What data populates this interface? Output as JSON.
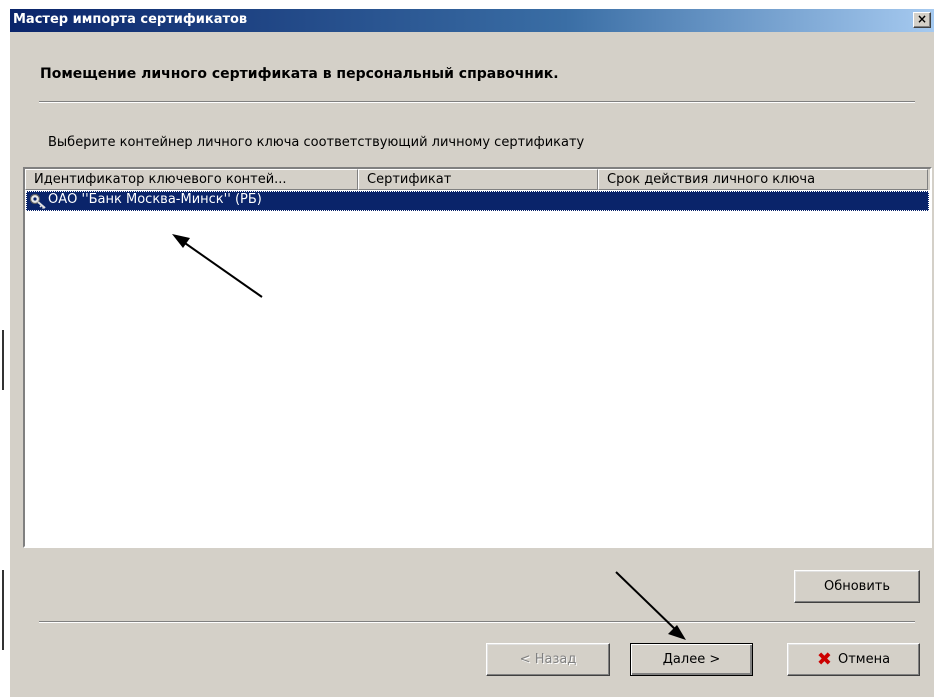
{
  "window": {
    "title": "Мастер импорта сертификатов",
    "close_glyph": "×"
  },
  "heading": "Помещение личного сертификата в персональный справочник.",
  "instruction": "Выберите контейнер личного ключа соответствующий личному сертификату",
  "list": {
    "columns": [
      "Идентификатор ключевого контей...",
      "Сертификат",
      "Срок действия личного ключа"
    ],
    "rows": [
      {
        "icon": "key-icon",
        "name": "ОАО ''Банк Москва-Минск'' (РБ)",
        "certificate": "",
        "expiry": "",
        "selected": true
      }
    ]
  },
  "buttons": {
    "refresh": "Обновить",
    "back": "< Назад",
    "next": "Далее >",
    "cancel": "Отмена",
    "cancel_icon": "cross-icon"
  },
  "colors": {
    "titlebar": "#0a246a",
    "selection": "#0a246a",
    "face": "#d4d0c8",
    "cancel_icon": "#cc0000"
  }
}
